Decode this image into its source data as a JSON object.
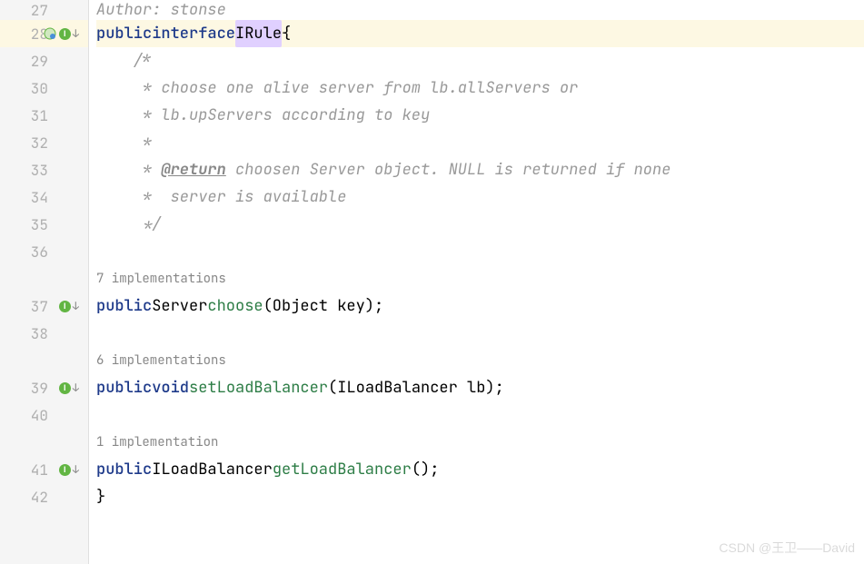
{
  "gutter": {
    "lines": [
      27,
      28,
      29,
      30,
      31,
      32,
      33,
      34,
      35,
      36,
      null,
      37,
      38,
      null,
      39,
      40,
      null,
      41,
      42
    ],
    "highlighted_line": 28,
    "icons": {
      "28": "class-impl",
      "37": "impl",
      "39": "impl",
      "41": "impl"
    }
  },
  "code": {
    "line27_class": "Author: stonse",
    "line28": {
      "kw1": "public",
      "kw2": "interface",
      "name": "IRule",
      "brace": "{"
    },
    "line29": "    /*",
    "line30": "     * choose one alive server from lb.allServers or",
    "line31": "     * lb.upServers according to key",
    "line32": "     * ",
    "line33_a": "     * ",
    "line33_b": "@return",
    "line33_c": " choosen Server object. NULL is returned if none",
    "line34": "     *  server is available",
    "line35": "     */",
    "line36": "",
    "inlay37": "7 implementations",
    "line37": {
      "kw": "public",
      "ret": "Server",
      "method": "choose",
      "params": "(Object key);"
    },
    "line38": "",
    "inlay39": "6 implementations",
    "line39": {
      "kw1": "public",
      "kw2": "void",
      "method": "setLoadBalancer",
      "params": "(ILoadBalancer lb);"
    },
    "line40": "",
    "inlay41": "1 implementation",
    "line41": {
      "kw": "public",
      "ret": "ILoadBalancer",
      "method": "getLoadBalancer",
      "params": "();"
    },
    "line42": "}"
  },
  "watermark": "CSDN @王卫——David",
  "icon_labels": {
    "impl_letter": "I",
    "down_arrow": "↓"
  }
}
